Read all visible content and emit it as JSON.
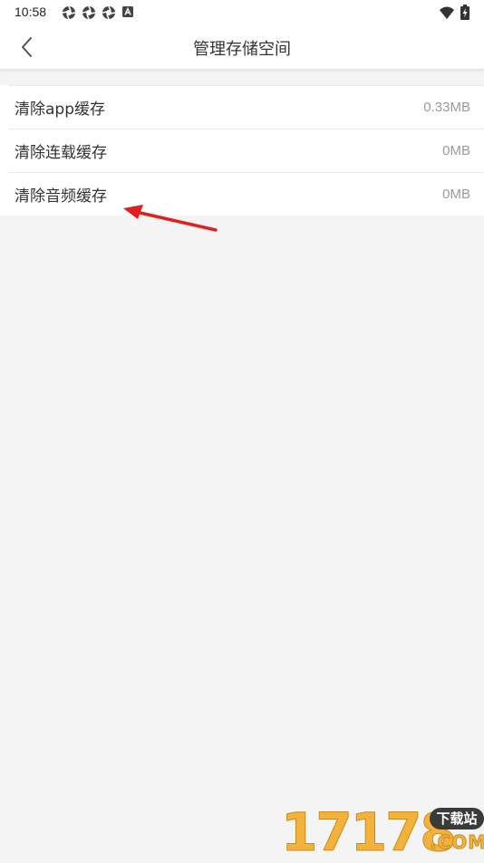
{
  "status_bar": {
    "time": "10:58",
    "left_icons": [
      "aperture-icon",
      "aperture-icon",
      "aperture-icon",
      "a-badge-icon"
    ],
    "right_icons": [
      "wifi-icon",
      "battery-charging-icon"
    ]
  },
  "nav": {
    "title": "管理存储空间",
    "back_icon": "chevron-left-icon"
  },
  "items": [
    {
      "label": "清除app缓存",
      "value": "0.33MB"
    },
    {
      "label": "清除连载缓存",
      "value": "0MB"
    },
    {
      "label": "清除音频缓存",
      "value": "0MB"
    }
  ],
  "annotation": {
    "color": "#e02020"
  },
  "watermark": {
    "digits": "17178",
    "badge": "下载站",
    "suffix": ".COM"
  },
  "colors": {
    "background": "#f4f4f4",
    "surface": "#ffffff",
    "text": "#333333",
    "secondary_text": "#9b9b9b",
    "watermark": "#f2b23c"
  }
}
